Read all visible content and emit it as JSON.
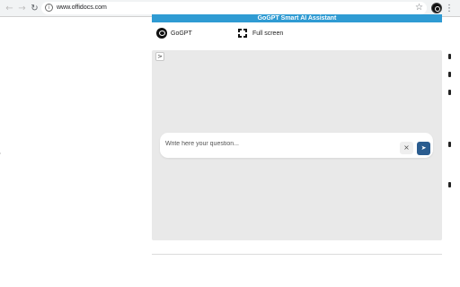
{
  "browser": {
    "back_glyph": "←",
    "forward_glyph": "→",
    "reload_glyph": "↻",
    "info_glyph": "i",
    "url": "www.offidocs.com",
    "star_glyph": "☆",
    "menu_glyph": "⋮",
    "icons": {
      "back": "arrow-left-icon",
      "forward": "arrow-right-icon",
      "reload": "reload-icon",
      "info": "info-icon",
      "star": "star-icon",
      "extension": "gogpt-extension-icon",
      "menu": "kebab-menu-icon"
    }
  },
  "extension": {
    "title": "GoGPT Smart AI Assistant",
    "gogpt_label": "GoGPT",
    "fullscreen_label": "Full screen",
    "expand_glyph": ">",
    "question_placeholder": "Write here your question...",
    "question_value": "",
    "clear_glyph": "×",
    "send_glyph": "➤",
    "colors": {
      "title_bar": "#2f9bd3",
      "send_button": "#2a5c8f",
      "chat_background": "#e9e9e9"
    }
  }
}
